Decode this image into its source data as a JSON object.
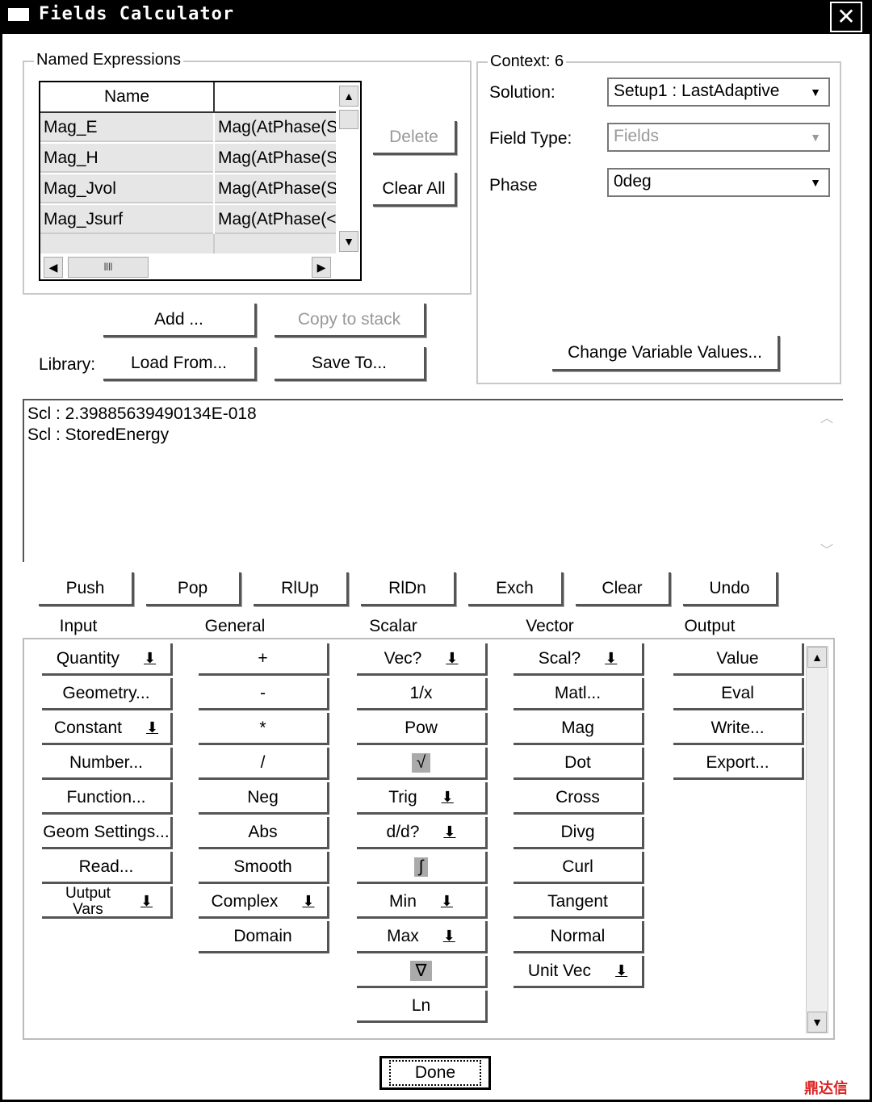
{
  "window": {
    "title": "Fields Calculator",
    "close_icon": "close-icon"
  },
  "named_expressions": {
    "label": "Named Expressions",
    "header_name": "Name",
    "header_expr": "",
    "rows": [
      {
        "name": "Mag_E",
        "expr": "Mag(AtPhase(Sr"
      },
      {
        "name": "Mag_H",
        "expr": "Mag(AtPhase(Sr"
      },
      {
        "name": "Mag_Jvol",
        "expr": "Mag(AtPhase(Sr"
      },
      {
        "name": "Mag_Jsurf",
        "expr": "Mag(AtPhase(<J"
      }
    ],
    "delete": "Delete",
    "clear_all": "Clear All",
    "add": "Add ...",
    "copy_to_stack": "Copy to stack",
    "library_label": "Library:",
    "load_from": "Load From...",
    "save_to": "Save To..."
  },
  "context": {
    "label": "Context: 6",
    "solution_label": "Solution:",
    "solution_value": "Setup1 : LastAdaptive",
    "field_type_label": "Field Type:",
    "field_type_value": "Fields",
    "phase_label": "Phase",
    "phase_value": "0deg",
    "change_vars": "Change Variable Values..."
  },
  "stack": {
    "lines": [
      "Scl : 2.39885639490134E-018",
      "Scl : StoredEnergy"
    ]
  },
  "stack_buttons": [
    "Push",
    "Pop",
    "RlUp",
    "RlDn",
    "Exch",
    "Clear",
    "Undo"
  ],
  "columns": [
    {
      "label": "Input",
      "buttons": [
        {
          "label": "Quantity",
          "dropdown": true
        },
        {
          "label": "Geometry..."
        },
        {
          "label": "Constant",
          "dropdown": true
        },
        {
          "label": "Number..."
        },
        {
          "label": "Function..."
        },
        {
          "label": "Geom Settings..."
        },
        {
          "label": "Read..."
        },
        {
          "label": "Uutput Vars",
          "dropdown": true
        }
      ]
    },
    {
      "label": "General",
      "buttons": [
        {
          "label": "+"
        },
        {
          "label": "-"
        },
        {
          "label": "*"
        },
        {
          "label": "/"
        },
        {
          "label": "Neg"
        },
        {
          "label": "Abs"
        },
        {
          "label": "Smooth"
        },
        {
          "label": "Complex",
          "dropdown": true
        },
        {
          "label": "Domain"
        }
      ]
    },
    {
      "label": "Scalar",
      "buttons": [
        {
          "label": "Vec?",
          "dropdown": true
        },
        {
          "label": "1/x"
        },
        {
          "label": "Pow"
        },
        {
          "label": "√",
          "icon": "sqrt-icon"
        },
        {
          "label": "Trig",
          "dropdown": true
        },
        {
          "label": "d/d?",
          "dropdown": true
        },
        {
          "label": "∫",
          "icon": "integral-icon"
        },
        {
          "label": "Min",
          "dropdown": true
        },
        {
          "label": "Max",
          "dropdown": true
        },
        {
          "label": "∇",
          "icon": "gradient-icon"
        },
        {
          "label": "Ln"
        }
      ]
    },
    {
      "label": "Vector",
      "buttons": [
        {
          "label": "Scal?",
          "dropdown": true
        },
        {
          "label": "Matl..."
        },
        {
          "label": "Mag"
        },
        {
          "label": "Dot"
        },
        {
          "label": "Cross"
        },
        {
          "label": "Divg"
        },
        {
          "label": "Curl"
        },
        {
          "label": "Tangent"
        },
        {
          "label": "Normal"
        },
        {
          "label": "Unit Vec",
          "dropdown": true
        }
      ]
    },
    {
      "label": "Output",
      "buttons": [
        {
          "label": "Value"
        },
        {
          "label": "Eval"
        },
        {
          "label": "Write..."
        },
        {
          "label": "Export..."
        }
      ]
    }
  ],
  "done": "Done",
  "watermark": "鼎达信"
}
